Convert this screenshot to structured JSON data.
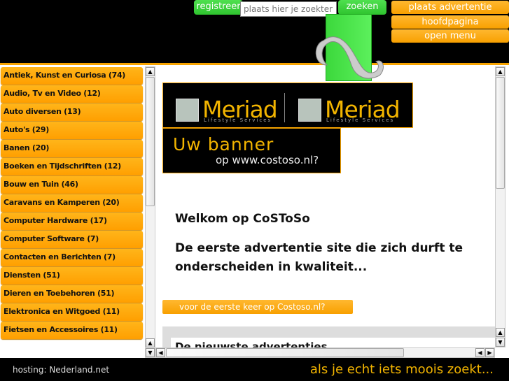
{
  "header": {
    "register_label": "registreer",
    "search_placeholder": "plaats hier je zoekterm",
    "search_button": "zoeken",
    "nav": [
      "plaats advertentie",
      "hoofdpagina",
      "open menu"
    ]
  },
  "sidebar": {
    "categories": [
      "Antiek, Kunst en Curiosa (74)",
      "Audio, Tv en Video (12)",
      "Auto diversen (13)",
      "Auto's (29)",
      "Banen (20)",
      "Boeken en Tijdschriften (12)",
      "Bouw en Tuin (46)",
      "Caravans en Kamperen (20)",
      "Computer Hardware (17)",
      "Computer Software (7)",
      "Contacten en Berichten (7)",
      "Diensten (51)",
      "Dieren en Toebehoren (51)",
      "Elektronica en Witgoed (11)",
      "Fietsen en Accessoires (11)"
    ]
  },
  "banners": {
    "meriad": "Meriad",
    "meriad_sub": "Lifestyle Services",
    "uw_banner": "Uw banner",
    "uw_banner_sub": "op www.costoso.nl?"
  },
  "main": {
    "welcome": "Welkom op CoSToSo",
    "tagline": "De eerste advertentie site die zich durft te onderscheiden in kwaliteit...",
    "first_time_button": "voor de eerste keer op Costoso.nl?",
    "newest_heading": "De nieuwste advertenties"
  },
  "footer": {
    "hosting": "hosting: Nederland.net",
    "slogan": "als je echt iets moois zoekt..."
  },
  "colors": {
    "orange": "#f7a400",
    "green": "#3cd83c",
    "black": "#000000"
  }
}
